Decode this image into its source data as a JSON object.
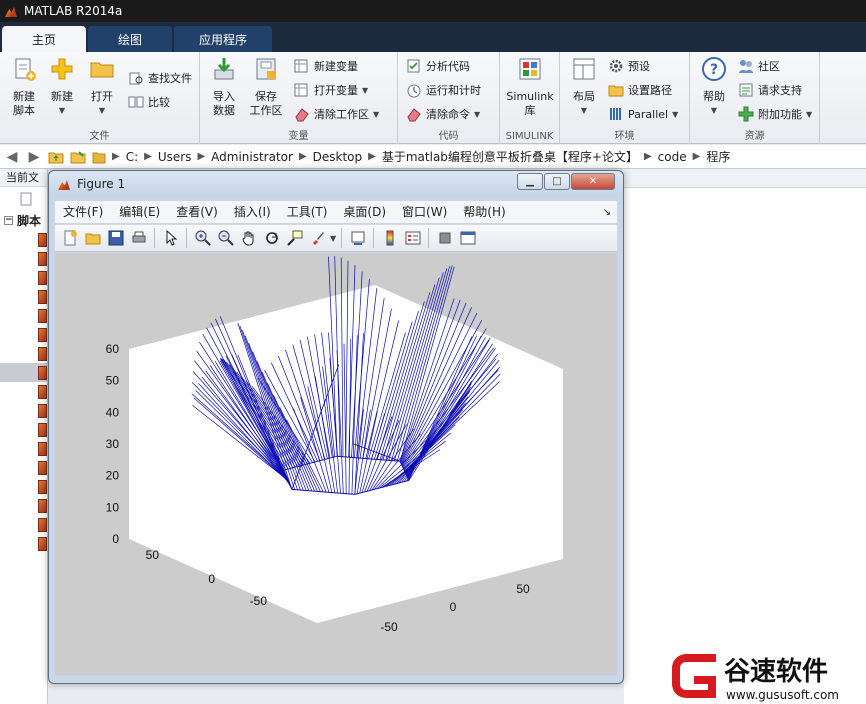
{
  "app": {
    "title": "MATLAB R2014a"
  },
  "tabs": [
    {
      "label": "主页",
      "active": true
    },
    {
      "label": "绘图",
      "active": false
    },
    {
      "label": "应用程序",
      "active": false
    }
  ],
  "ribbon": {
    "file": {
      "label": "文件",
      "new_script": "新建\n脚本",
      "new": "新建",
      "open": "打开",
      "find_files": "查找文件",
      "compare": "比较"
    },
    "variable": {
      "label": "变量",
      "import": "导入\n数据",
      "save": "保存\n工作区",
      "new_var": "新建变量",
      "open_var": "打开变量",
      "clear_ws": "清除工作区"
    },
    "code": {
      "label": "代码",
      "analyze": "分析代码",
      "run_time": "运行和计时",
      "clear_cmd": "清除命令"
    },
    "simulink": {
      "label": "SIMULINK",
      "lib": "Simulink\n库"
    },
    "environment": {
      "label": "环境",
      "layout": "布局",
      "prefs": "预设",
      "set_path": "设置路径",
      "parallel": "Parallel"
    },
    "resources": {
      "label": "资源",
      "help": "帮助",
      "community": "社区",
      "support": "请求支持",
      "addons": "附加功能"
    }
  },
  "address": {
    "segments": [
      "C:",
      "Users",
      "Administrator",
      "Desktop",
      "基于matlab编程创意平板折叠桌【程序+论文】",
      "code",
      "程序"
    ]
  },
  "leftpanel": {
    "header": "当前文",
    "group": "脚本"
  },
  "figure": {
    "title": "Figure 1",
    "menu": [
      "文件(F)",
      "编辑(E)",
      "查看(V)",
      "插入(I)",
      "工具(T)",
      "桌面(D)",
      "窗口(W)",
      "帮助(H)"
    ],
    "zticks": [
      "0",
      "10",
      "20",
      "30",
      "40",
      "50",
      "60"
    ],
    "xticks": [
      "-50",
      "0",
      "50"
    ],
    "yticks": [
      "-50",
      "0",
      "50"
    ]
  },
  "watermark": {
    "brand": "谷速软件",
    "url": "www.gususoft.com"
  },
  "colors": {
    "mesh": "#0b0bb4",
    "plot_bg": "#cccccc",
    "axes_bg": "#ffffff"
  }
}
